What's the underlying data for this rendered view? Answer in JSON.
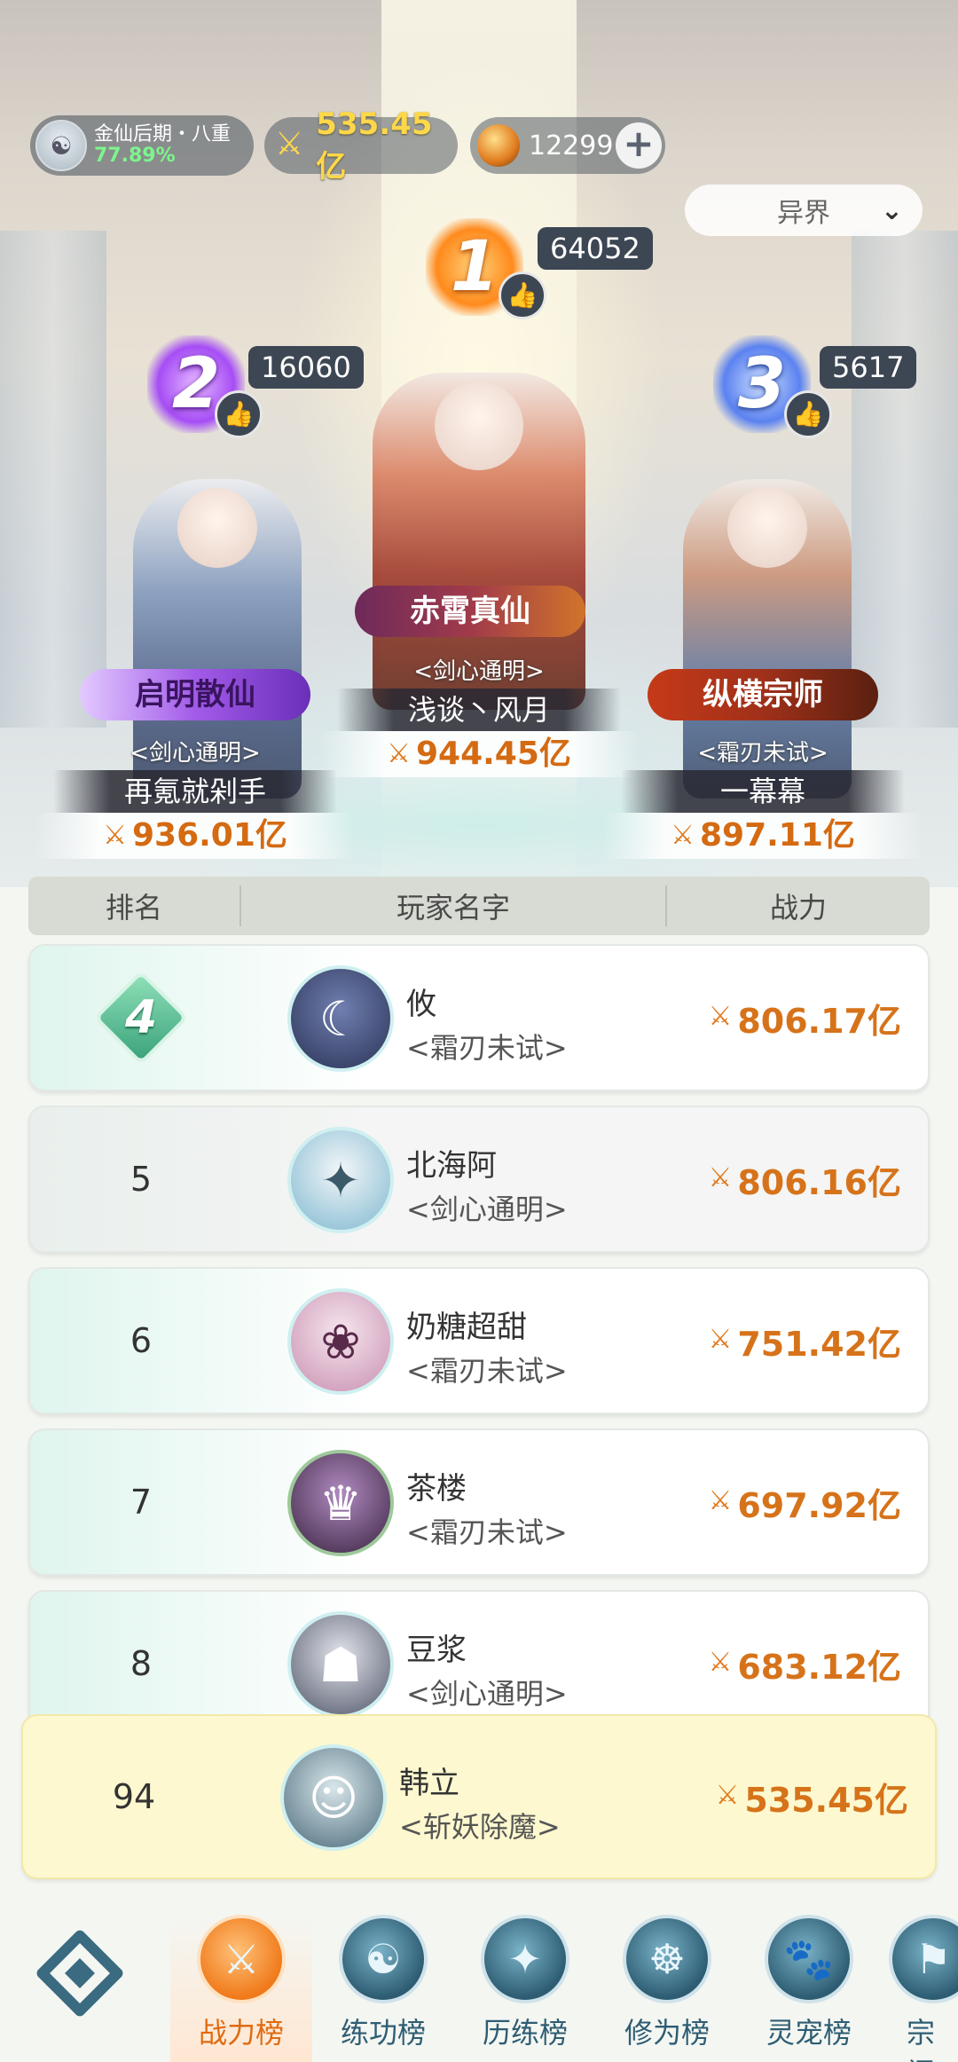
{
  "header": {
    "realm": "金仙后期・八重",
    "realm_progress": "77.89%",
    "player_power": "535.45亿",
    "currency_amount": "12299",
    "plus_symbol": "+",
    "server_dropdown": "异界"
  },
  "podium": [
    {
      "rank": "1",
      "likes": "64052",
      "title": "赤霄真仙",
      "tag": "<剑心通明>",
      "name": "浅谈丶风月",
      "power": "944.45亿"
    },
    {
      "rank": "2",
      "likes": "16060",
      "title": "启明散仙",
      "tag": "<剑心通明>",
      "name": "再氪就剁手",
      "power": "936.01亿"
    },
    {
      "rank": "3",
      "likes": "5617",
      "title": "纵横宗师",
      "tag": "<霜刃未试>",
      "name": "一幕幕",
      "power": "897.11亿"
    }
  ],
  "table": {
    "headers": [
      "排名",
      "玩家名字",
      "战力"
    ],
    "rows": [
      {
        "rank": "4",
        "name": "攸",
        "tag": "<霜刃未试>",
        "power": "806.17亿"
      },
      {
        "rank": "5",
        "name": "北海阿",
        "tag": "<剑心通明>",
        "power": "806.16亿"
      },
      {
        "rank": "6",
        "name": "奶糖超甜",
        "tag": "<霜刃未试>",
        "power": "751.42亿"
      },
      {
        "rank": "7",
        "name": "茶楼",
        "tag": "<霜刃未试>",
        "power": "697.92亿"
      },
      {
        "rank": "8",
        "name": "豆浆",
        "tag": "<剑心通明>",
        "power": "683.12亿"
      }
    ],
    "my_row": {
      "rank": "94",
      "name": "韩立",
      "tag": "<斩妖除魔>",
      "power": "535.45亿"
    }
  },
  "nav": {
    "items": [
      "战力榜",
      "练功榜",
      "历练榜",
      "修为榜",
      "灵宠榜",
      "宗门"
    ],
    "active": "战力榜"
  },
  "colors": {
    "accent": "#f07a1a",
    "power_text": "#d6731a",
    "nav_text": "#2e5d73"
  }
}
